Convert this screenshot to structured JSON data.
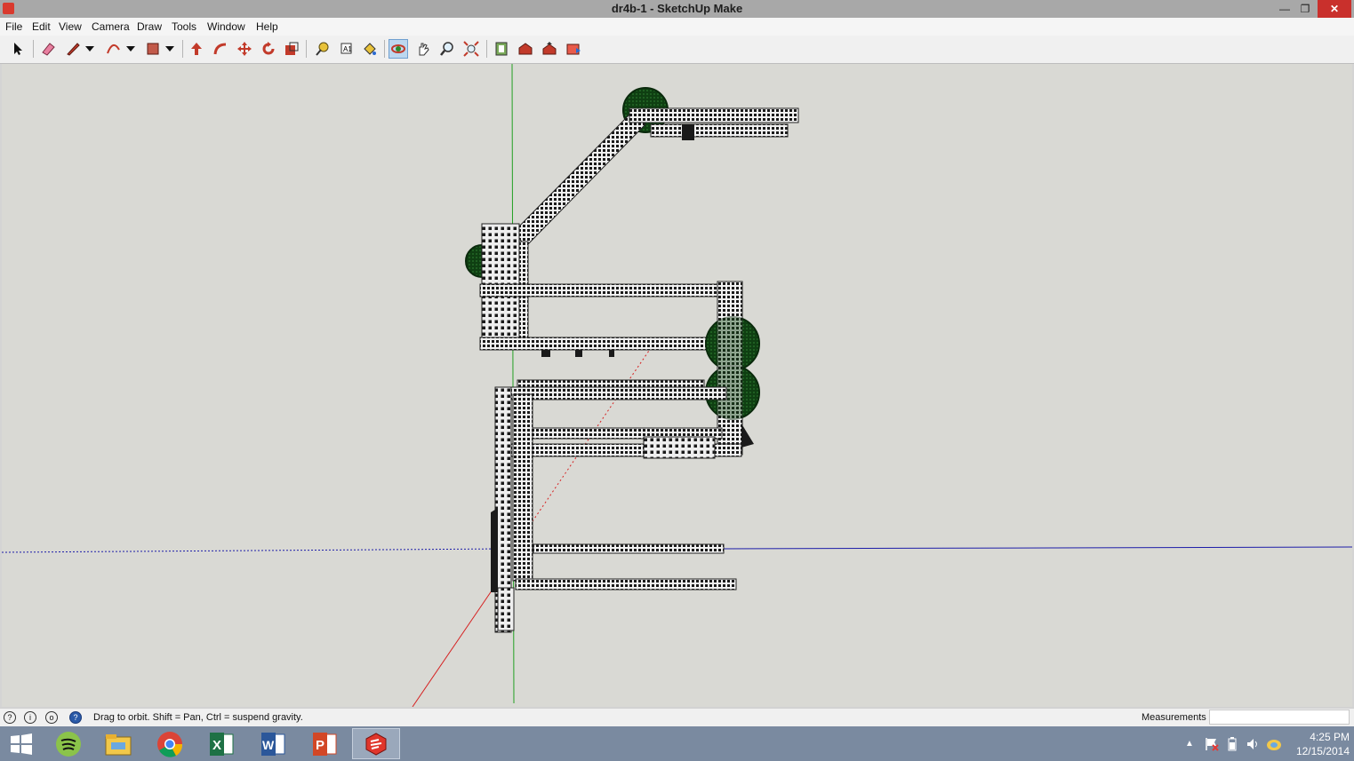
{
  "window": {
    "title": "dr4b-1 - SketchUp Make"
  },
  "menu": [
    "File",
    "Edit",
    "View",
    "Camera",
    "Draw",
    "Tools",
    "Window",
    "Help"
  ],
  "toolbar": {
    "tools": [
      "select-arrow-icon",
      "eraser-icon",
      "pencil-line-icon",
      "dropdown-arrow-icon",
      "arc-icon",
      "dropdown-arrow-icon",
      "rectangle-icon",
      "dropdown-arrow-icon",
      "push-pull-icon",
      "follow-me-icon",
      "move-icon",
      "rotate-icon",
      "scale-icon",
      "tape-measure-icon",
      "dimension-text-icon",
      "paint-bucket-icon",
      "orbit-icon",
      "pan-icon",
      "zoom-icon",
      "zoom-extents-icon",
      "model-info-icon",
      "warehouse-get-icon",
      "warehouse-share-icon",
      "extension-warehouse-icon"
    ],
    "active_tool": "orbit-icon"
  },
  "status": {
    "hint": "Drag to orbit. Shift = Pan, Ctrl = suspend gravity.",
    "measurements_label": "Measurements",
    "measurements_value": ""
  },
  "taskbar": {
    "apps": [
      "windows-start-icon",
      "spotify-icon",
      "file-explorer-icon",
      "chrome-icon",
      "excel-icon",
      "word-icon",
      "powerpoint-icon",
      "sketchup-icon"
    ],
    "active_app": "sketchup-icon",
    "time": "4:25 PM",
    "date": "12/15/2014"
  },
  "colors": {
    "axis_red": "#d62020",
    "axis_green": "#22a022",
    "axis_blue": "#1d1da8",
    "gear_green": "#0f3f12",
    "accent_close": "#c9302c"
  }
}
